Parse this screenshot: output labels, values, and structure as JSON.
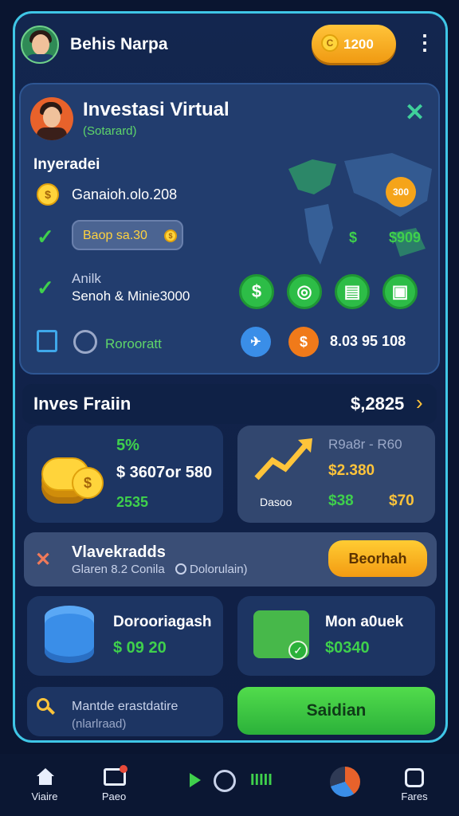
{
  "header": {
    "username": "Behis Narpa",
    "coins": "1200",
    "more": "⋮"
  },
  "panel": {
    "title": "Investasi Virtual",
    "subtitle": "(Sotarard)",
    "section_label": "Inyeradei",
    "balance_text": "Ganaioh.olo.208",
    "badge_text": "Baop sa.30",
    "rows": [
      {
        "line1": "Anilk",
        "line2": "Senoh & Minie3000"
      }
    ],
    "footer_label": "Rorooratt",
    "footer_value": "8.03 95 108",
    "map_badge": "300",
    "map_dollar": "$",
    "map_value": "$909"
  },
  "invest_header": {
    "title": "Inves Fraiin",
    "amount": "$,2825",
    "chevron": "›"
  },
  "card_left": {
    "percent": "5%",
    "amount": "$ 3607or 580",
    "sub": "2535"
  },
  "card_right": {
    "top": "R9a8r - R60",
    "mid": "$2.380",
    "label": "Dasoo",
    "v1": "$38",
    "v2": "$70"
  },
  "action": {
    "title": "Vlavekradds",
    "subtitle": "Glaren 8.2 Conila",
    "extra": "Dolorulain)",
    "button": "Beorhah"
  },
  "tile_left": {
    "title": "Dorooriagash",
    "value": "$ 09 20"
  },
  "tile_right": {
    "title": "Mon a0uek",
    "value": "$0340"
  },
  "search": {
    "line1": "Mantde erastdatire",
    "line2": "(nlarlraad)",
    "button": "Saidian"
  },
  "nav": [
    {
      "label": "Viaire"
    },
    {
      "label": "Paeo"
    },
    {
      "label": "Fares"
    }
  ],
  "colors": {
    "accent": "#3fc6e6",
    "green": "#2dbd47",
    "orange": "#f5a41a"
  }
}
